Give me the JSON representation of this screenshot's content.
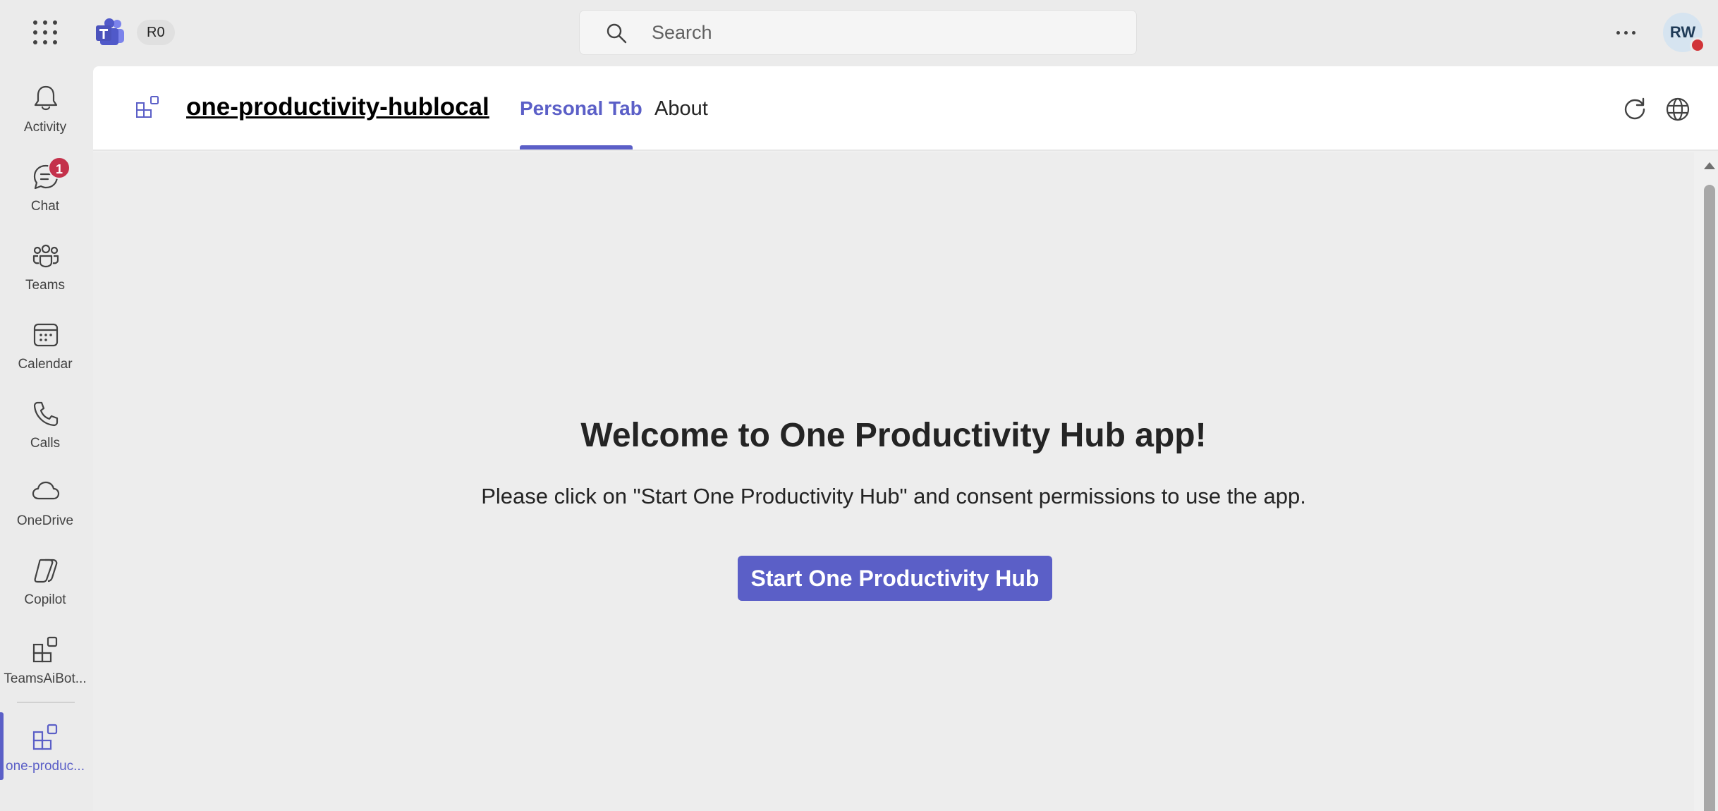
{
  "topbar": {
    "tenant_badge": "R0",
    "search": {
      "placeholder": "Search",
      "value": ""
    },
    "avatar_initials": "RW",
    "icons": [
      "app-launcher-icon",
      "teams-logo-icon",
      "search-icon",
      "more-options-icon",
      "presence-busy-icon"
    ]
  },
  "rail": {
    "items": [
      {
        "label": "Activity",
        "icon": "bell-icon"
      },
      {
        "label": "Chat",
        "icon": "chat-icon",
        "badge": "1"
      },
      {
        "label": "Teams",
        "icon": "teams-icon"
      },
      {
        "label": "Calendar",
        "icon": "calendar-icon"
      },
      {
        "label": "Calls",
        "icon": "phone-icon"
      },
      {
        "label": "OneDrive",
        "icon": "cloud-icon"
      },
      {
        "label": "Copilot",
        "icon": "copilot-icon"
      },
      {
        "label": "TeamsAiBot...",
        "icon": "apps-icon"
      },
      {
        "label": "one-produc...",
        "icon": "apps-icon",
        "active": true
      }
    ]
  },
  "app": {
    "title": "one-productivity-hublocal",
    "tabs": [
      {
        "label": "Personal Tab",
        "active": true
      },
      {
        "label": "About",
        "active": false
      }
    ],
    "header_icons": [
      "refresh-icon",
      "globe-icon"
    ]
  },
  "content": {
    "welcome": "Welcome to One Productivity Hub app!",
    "instructions": "Please click on \"Start One Productivity Hub\" and consent permissions to use the app.",
    "start_button": "Start One Productivity Hub"
  },
  "colors": {
    "accent": "#5b5fc7",
    "badge": "#c4314b",
    "presence_busy": "#d13438",
    "background": "#ebebeb"
  }
}
